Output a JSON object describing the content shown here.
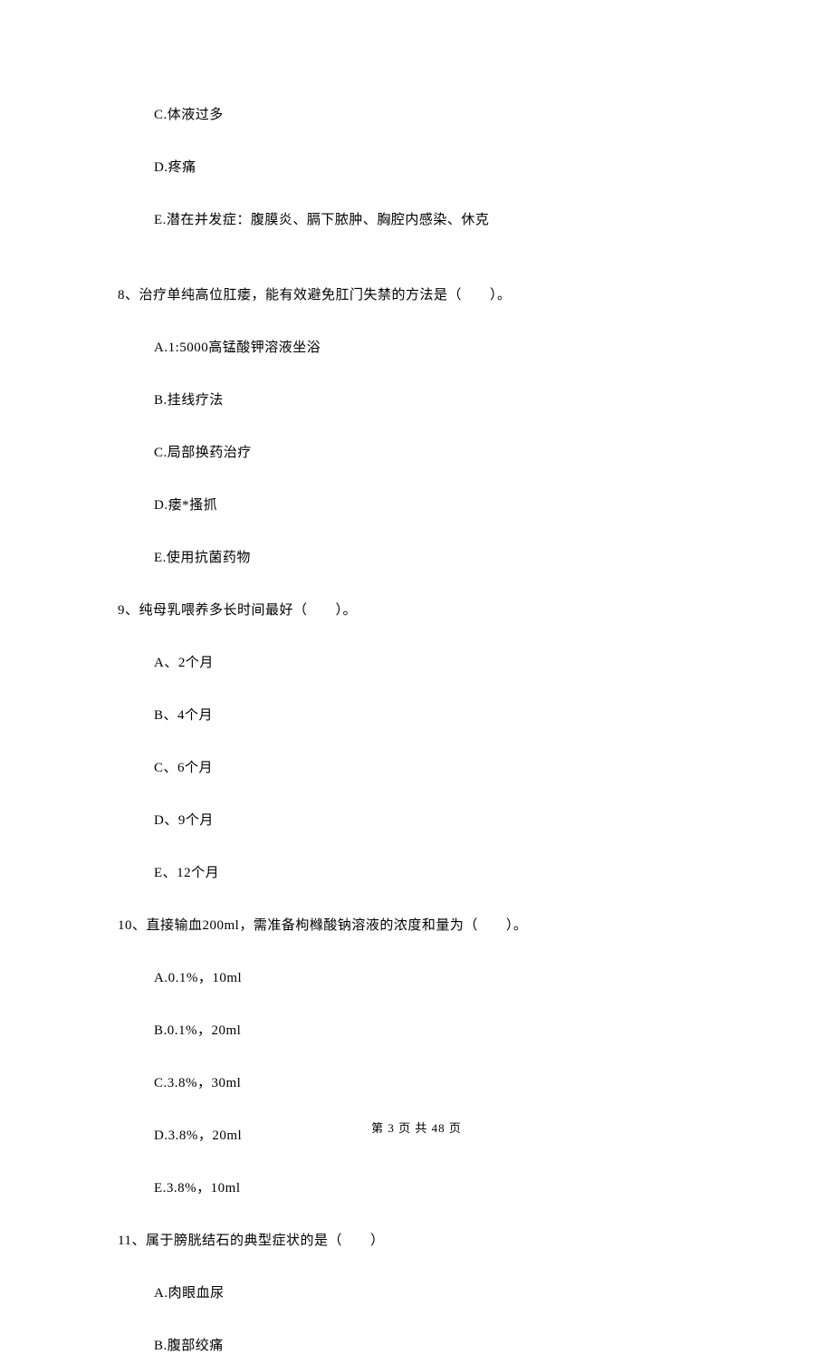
{
  "q7_options": {
    "c": "C.体液过多",
    "d": "D.疼痛",
    "e": "E.潜在并发症：腹膜炎、膈下脓肿、胸腔内感染、休克"
  },
  "q8": {
    "stem": "8、治疗单纯高位肛瘘，能有效避免肛门失禁的方法是（　　）。",
    "a": "A.1:5000高锰酸钾溶液坐浴",
    "b": "B.挂线疗法",
    "c": "C.局部换药治疗",
    "d": "D.瘘*搔抓",
    "e": "E.使用抗菌药物"
  },
  "q9": {
    "stem": "9、纯母乳喂养多长时间最好（　　）。",
    "a": "A、2个月",
    "b": "B、4个月",
    "c": "C、6个月",
    "d": "D、9个月",
    "e": "E、12个月"
  },
  "q10": {
    "stem": "10、直接输血200ml，需准备枸橼酸钠溶液的浓度和量为（　　）。",
    "a": "A.0.1%，10ml",
    "b": "B.0.1%，20ml",
    "c": "C.3.8%，30ml",
    "d": "D.3.8%，20ml",
    "e": "E.3.8%，10ml"
  },
  "q11": {
    "stem": "11、属于膀胱结石的典型症状的是（　　）",
    "a": "A.肉眼血尿",
    "b": "B.腹部绞痛"
  },
  "footer": "第 3 页 共 48 页"
}
